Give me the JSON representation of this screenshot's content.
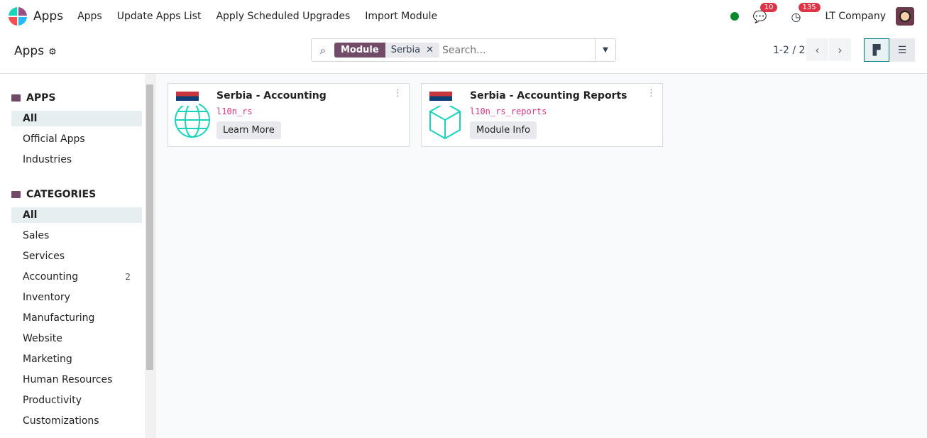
{
  "topbar": {
    "brand": "Apps",
    "menu": [
      "Apps",
      "Update Apps List",
      "Apply Scheduled Upgrades",
      "Import Module"
    ],
    "messages_count": "10",
    "activities_count": "135",
    "company": "LT Company"
  },
  "control": {
    "title": "Apps",
    "facet_key": "Module",
    "facet_value": "Serbia",
    "search_placeholder": "Search...",
    "pager": "1-2 / 2"
  },
  "sidebar": {
    "apps_heading": "APPS",
    "apps": [
      {
        "label": "All"
      },
      {
        "label": "Official Apps"
      },
      {
        "label": "Industries"
      }
    ],
    "categories_heading": "CATEGORIES",
    "categories": [
      {
        "label": "All"
      },
      {
        "label": "Sales"
      },
      {
        "label": "Services"
      },
      {
        "label": "Accounting",
        "count": "2"
      },
      {
        "label": "Inventory"
      },
      {
        "label": "Manufacturing"
      },
      {
        "label": "Website"
      },
      {
        "label": "Marketing"
      },
      {
        "label": "Human Resources"
      },
      {
        "label": "Productivity"
      },
      {
        "label": "Customizations"
      }
    ]
  },
  "modules": [
    {
      "name": "Serbia - Accounting",
      "technical": "l10n_rs",
      "button": "Learn More",
      "icon": "globe-icon"
    },
    {
      "name": "Serbia - Accounting Reports",
      "technical": "l10n_rs_reports",
      "button": "Module Info",
      "icon": "cube-icon"
    }
  ],
  "colors": {
    "accent": "#714b67",
    "teal": "#017e84",
    "icon": "#1ad3bb"
  }
}
